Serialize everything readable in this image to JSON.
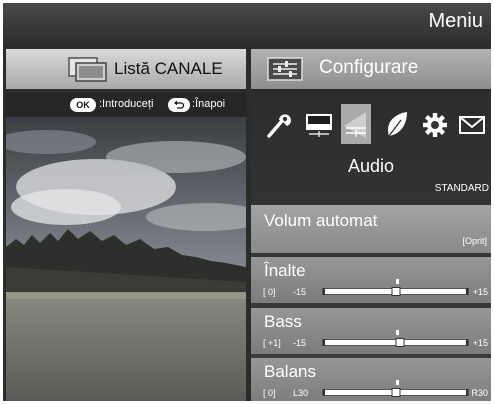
{
  "header": {
    "title": "Meniu"
  },
  "tabs": {
    "channel_list": "Listă CANALE",
    "setup": "Configurare"
  },
  "hints": {
    "ok_key": "OK",
    "ok_text": ":Introduceți",
    "back_text": ":Înapoi"
  },
  "setup": {
    "category_icons": [
      "wrench-icon",
      "picture-icon",
      "audio-icon",
      "leaf-icon",
      "gear-icon",
      "envelope-icon"
    ],
    "selected_category": "Audio",
    "preset": "STANDARD",
    "volum_automat": {
      "label": "Volum automat",
      "value": "[Oprit]"
    },
    "sliders": [
      {
        "label": "Înalte",
        "current": "[   0]",
        "min_label": "-15",
        "max_label": "+15",
        "min": -15,
        "max": 15,
        "value": 0
      },
      {
        "label": "Bass",
        "current": "[  +1]",
        "min_label": "-15",
        "max_label": "+15",
        "min": -15,
        "max": 15,
        "value": 1
      },
      {
        "label": "Balans",
        "current": "[   0]",
        "min_label": "L30",
        "max_label": "R30",
        "min": -30,
        "max": 30,
        "value": 0
      }
    ]
  }
}
